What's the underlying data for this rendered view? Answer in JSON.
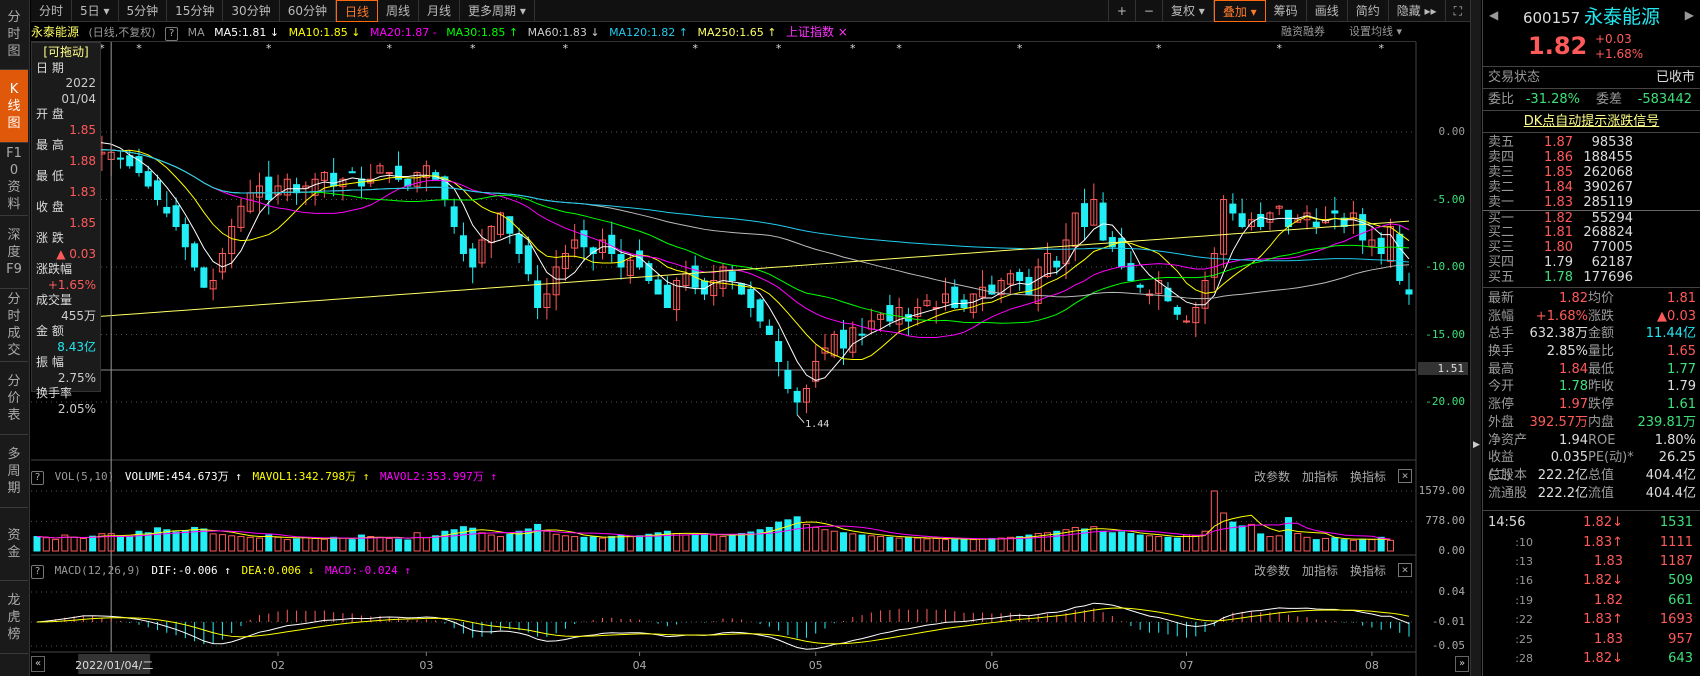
{
  "sidebar": [
    "分时图",
    "K线图",
    "F10资料",
    "深度F9",
    "分时成交",
    "分价表",
    "多周期",
    "资金",
    "龙虎榜"
  ],
  "toolbar": {
    "periods": [
      "分时",
      "5日 ▾",
      "5分钟",
      "15分钟",
      "30分钟",
      "60分钟",
      "日线",
      "周线",
      "月线",
      "更多周期 ▾"
    ],
    "active": "日线",
    "right": [
      "+",
      "−",
      "复权 ▾",
      "叠加 ▾",
      "筹码",
      "画线",
      "简约",
      "隐藏 ▸▸"
    ],
    "fullscreen": "⛶"
  },
  "title": {
    "name": "永泰能源",
    "mode": "(日线,不复权)",
    "ma": "MA",
    "ma5": "MA5:1.81 ↓",
    "ma10": "MA10:1.85 ↓",
    "ma20": "MA20:1.87 -",
    "ma30": "MA30:1.85 ↑",
    "ma60": "MA60:1.83 ↓",
    "ma120": "MA120:1.82 ↑",
    "ma250": "MA250:1.65 ↑",
    "overlay": "上证指数 ×",
    "margin": "融资融券",
    "set_ma": "设置均线 ▾"
  },
  "info": {
    "drag": "[可拖动]",
    "rows": [
      [
        "日  期",
        "2022\n01/04"
      ],
      [
        "开  盘",
        "1.85"
      ],
      [
        "最  高",
        "1.88"
      ],
      [
        "最  低",
        "1.83"
      ],
      [
        "收  盘",
        "1.85"
      ],
      [
        "涨  跌",
        "▲ 0.03"
      ],
      [
        "涨跌幅",
        "+1.65%"
      ],
      [
        "成交量",
        "455万"
      ],
      [
        "金  额",
        "8.43亿"
      ],
      [
        "振  幅",
        "2.75%"
      ],
      [
        "换手率",
        "2.05%"
      ]
    ]
  },
  "axis": {
    "price": [
      "0.00",
      "-5.00",
      "-10.00",
      "-15.00",
      "-20.00"
    ],
    "cursor_value": "1.51",
    "low_label": "1.44",
    "vol": [
      "1579.00",
      "778.00",
      "0.00"
    ],
    "macd": [
      "0.04",
      "-0.01",
      "-0.05"
    ]
  },
  "vol_header": {
    "name": "VOL(5,10)",
    "volume": "VOLUME:454.673万 ↑",
    "mavol1": "MAVOL1:342.798万 ↑",
    "mavol2": "MAVOL2:353.997万 ↑"
  },
  "macd_header": {
    "name": "MACD(12,26,9)",
    "dif": "DIF:-0.006 ↑",
    "dea": "DEA:0.006 ↓",
    "macd": "MACD:-0.024 ↑"
  },
  "panel_buttons": [
    "改参数",
    "加指标",
    "换指标",
    "×"
  ],
  "dates": {
    "cursor": "2022/01/04/二",
    "months": [
      "02",
      "03",
      "04",
      "05",
      "06",
      "07",
      "08"
    ]
  },
  "colors": {
    "up": "#ff5a5a",
    "down": "#22eef5",
    "ma5": "#ffffff",
    "ma10": "#ffff00",
    "ma20": "#ff00ff",
    "ma30": "#00ff00",
    "ma60": "#bbbbbb",
    "ma120": "#22ccee",
    "ma250": "#ffff66",
    "accent": "#e0580a"
  },
  "chart_data": {
    "type": "candlestick",
    "unit": "percent",
    "ylim": [
      -20,
      0
    ],
    "closes": [
      -3,
      -2,
      -1.5,
      -1,
      -0.5,
      0,
      -1,
      -1.5,
      -1.5,
      -2,
      -2.5,
      -3,
      -4,
      -5,
      -6,
      -7,
      -8.5,
      -10,
      -11.5,
      -11,
      -9,
      -7,
      -5.5,
      -4.5,
      -4,
      -5,
      -4,
      -3.5,
      -4.5,
      -4,
      -3.5,
      -3,
      -4,
      -3.5,
      -3,
      -4,
      -3.5,
      -2.5,
      -3,
      -3.5,
      -4,
      -3,
      -2.5,
      -3.5,
      -5,
      -7,
      -9,
      -10,
      -8,
      -7,
      -6,
      -7.5,
      -9,
      -10.5,
      -13,
      -12,
      -10,
      -9,
      -8,
      -8.5,
      -9,
      -8,
      -9,
      -10,
      -9.5,
      -10,
      -11,
      -12,
      -13,
      -11,
      -10.5,
      -11.5,
      -12,
      -11,
      -10,
      -11,
      -12,
      -13,
      -14,
      -15,
      -17,
      -19,
      -20,
      -19,
      -17,
      -16,
      -15,
      -16,
      -14.5,
      -15,
      -14,
      -13.5,
      -14,
      -13,
      -14,
      -13,
      -12.5,
      -13,
      -12,
      -13,
      -13,
      -12,
      -11.5,
      -12,
      -11,
      -10.5,
      -11,
      -12,
      -10,
      -9,
      -10,
      -8,
      -6,
      -7,
      -5,
      -8,
      -8.5,
      -10,
      -11,
      -11.5,
      -12,
      -11,
      -12.5,
      -13.5,
      -14,
      -13,
      -11,
      -9,
      -5,
      -6,
      -7,
      -6.5,
      -7,
      -6,
      -5.5,
      -7,
      -6.5,
      -6,
      -7,
      -6.5,
      -6,
      -7,
      -6,
      -8,
      -8,
      -9,
      -7,
      -11,
      -12
    ],
    "volumes": [
      380,
      350,
      300,
      420,
      360,
      330,
      390,
      455,
      455,
      400,
      380,
      520,
      480,
      610,
      560,
      500,
      540,
      620,
      580,
      450,
      430,
      400,
      380,
      360,
      340,
      420,
      360,
      300,
      320,
      350,
      330,
      310,
      360,
      340,
      300,
      420,
      380,
      360,
      330,
      310,
      290,
      480,
      350,
      400,
      520,
      560,
      640,
      600,
      480,
      420,
      380,
      440,
      520,
      580,
      700,
      520,
      440,
      400,
      380,
      360,
      370,
      340,
      380,
      420,
      380,
      400,
      440,
      480,
      520,
      460,
      420,
      440,
      460,
      420,
      380,
      400,
      460,
      500,
      560,
      620,
      760,
      820,
      900,
      700,
      620,
      560,
      520,
      480,
      450,
      420,
      400,
      380,
      360,
      340,
      360,
      340,
      320,
      330,
      300,
      320,
      310,
      300,
      320,
      330,
      340,
      360,
      380,
      420,
      460,
      480,
      520,
      560,
      620,
      580,
      640,
      520,
      480,
      500,
      460,
      420,
      400,
      380,
      360,
      340,
      420,
      400,
      520,
      1579,
      1000,
      760,
      660,
      700,
      450,
      380,
      400,
      880,
      460,
      360,
      300,
      330,
      350,
      300,
      280,
      310,
      300,
      360,
      280
    ],
    "event_markers": [
      3,
      7,
      11,
      25,
      38,
      47,
      57,
      71,
      80,
      88,
      93,
      106,
      121,
      134,
      145
    ],
    "months_start": [
      26,
      42,
      65,
      84,
      103,
      124,
      144
    ],
    "cursor_index": 8
  }
}
